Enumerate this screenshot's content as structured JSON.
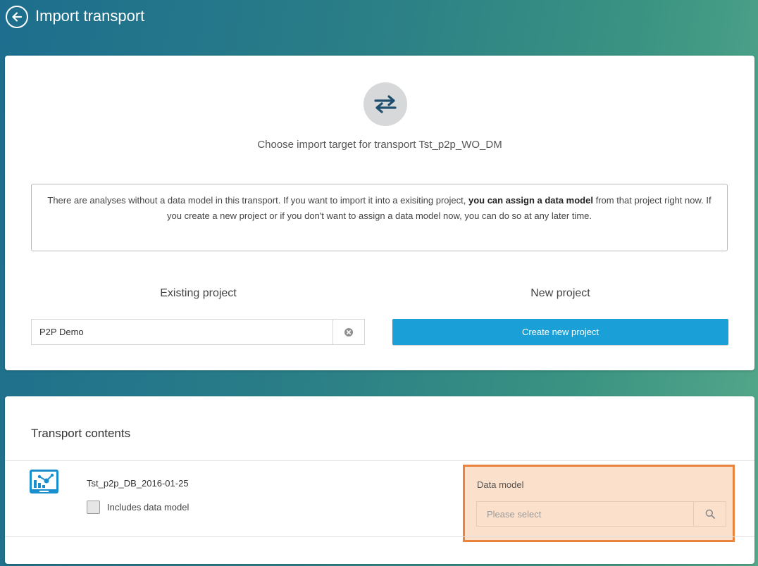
{
  "header": {
    "back_icon": "arrow-left-circle-icon",
    "title": "Import transport"
  },
  "import_target": {
    "icon": "swap-arrows-icon",
    "subtitle": "Choose import target for transport Tst_p2p_WO_DM",
    "info": {
      "part1": "There are analyses without a data model in this transport. If you want to import it into a exisiting project, ",
      "bold": "you can assign a data model",
      "part2": " from that project right now. If you create a new project or if you don't want to assign a data model now, you can do so at any later time."
    },
    "existing": {
      "heading": "Existing project",
      "value": "P2P Demo",
      "clear_icon": "clear-circle-icon"
    },
    "new_project": {
      "heading": "New project",
      "button_label": "Create new project"
    }
  },
  "transport_contents": {
    "title": "Transport contents",
    "items": [
      {
        "icon": "analysis-icon",
        "name": "Tst_p2p_DB_2016-01-25",
        "checkbox_label": "Includes data model",
        "checked": false,
        "data_model": {
          "label": "Data model",
          "placeholder": "Please select",
          "search_icon": "search-icon"
        }
      }
    ]
  },
  "colors": {
    "accent_button": "#1aa0d6",
    "highlight_border": "#e8843d",
    "highlight_fill": "#fbe0cc",
    "icon_blue": "#1a8fcf"
  }
}
